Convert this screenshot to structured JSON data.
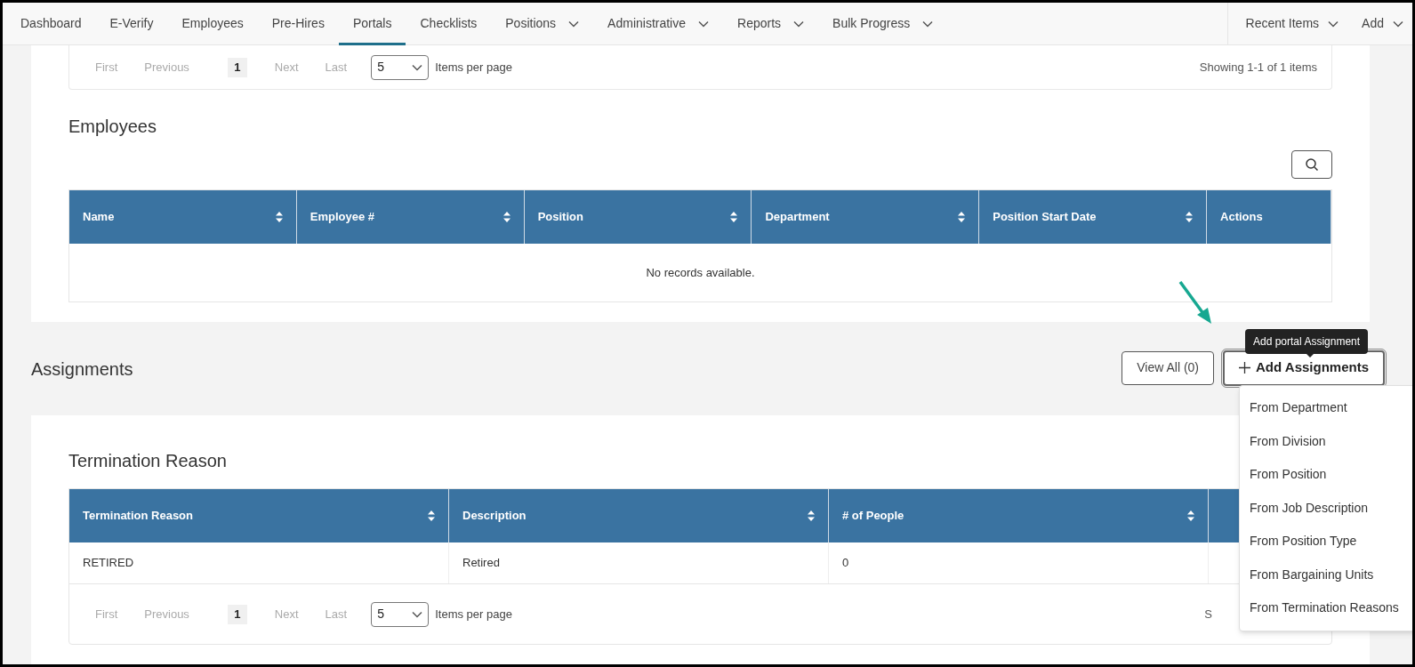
{
  "nav": {
    "items": [
      {
        "label": "Dashboard",
        "dropdown": false,
        "selected": false
      },
      {
        "label": "E-Verify",
        "dropdown": false,
        "selected": false
      },
      {
        "label": "Employees",
        "dropdown": false,
        "selected": false
      },
      {
        "label": "Pre-Hires",
        "dropdown": false,
        "selected": false
      },
      {
        "label": "Portals",
        "dropdown": false,
        "selected": true
      },
      {
        "label": "Checklists",
        "dropdown": false,
        "selected": false
      },
      {
        "label": "Positions",
        "dropdown": true,
        "selected": false
      },
      {
        "label": "Administrative",
        "dropdown": true,
        "selected": false
      },
      {
        "label": "Reports",
        "dropdown": true,
        "selected": false
      },
      {
        "label": "Bulk Progress",
        "dropdown": true,
        "selected": false
      }
    ],
    "right": [
      {
        "label": "Recent Items"
      },
      {
        "label": "Add"
      }
    ]
  },
  "top_pager": {
    "items": [
      {
        "kind": "link",
        "label": "First",
        "disabled": true
      },
      {
        "kind": "link",
        "label": "Previous",
        "disabled": true
      },
      {
        "kind": "page",
        "label": "1",
        "selected": true
      },
      {
        "kind": "link",
        "label": "Next",
        "disabled": true
      },
      {
        "kind": "link",
        "label": "Last",
        "disabled": true
      }
    ],
    "per_page": "5",
    "per_page_label": "Items per page",
    "summary": "Showing 1-1 of 1 items"
  },
  "employees": {
    "title": "Employees",
    "columns": [
      {
        "label": "Name",
        "sortable": true
      },
      {
        "label": "Employee #",
        "sortable": true
      },
      {
        "label": "Position",
        "sortable": true
      },
      {
        "label": "Department",
        "sortable": true
      },
      {
        "label": "Position Start Date",
        "sortable": true
      },
      {
        "label": "Actions",
        "sortable": false
      }
    ],
    "empty_message": "No records available."
  },
  "assignments": {
    "title": "Assignments",
    "view_all": "View All (0)",
    "add_button": "Add Assignments",
    "tooltip": "Add portal Assignment",
    "menu": [
      "From Department",
      "From Division",
      "From Position",
      "From Job Description",
      "From Position Type",
      "From Bargaining Units",
      "From Termination Reasons"
    ]
  },
  "termination": {
    "title": "Termination Reason",
    "columns": [
      {
        "label": "Termination Reason",
        "sortable": true
      },
      {
        "label": "Description",
        "sortable": true
      },
      {
        "label": "# of People",
        "sortable": true
      }
    ],
    "rows": [
      [
        "RETIRED",
        "Retired",
        "0"
      ]
    ],
    "pager": {
      "items": [
        {
          "kind": "link",
          "label": "First",
          "disabled": true
        },
        {
          "kind": "link",
          "label": "Previous",
          "disabled": true
        },
        {
          "kind": "page",
          "label": "1",
          "selected": true
        },
        {
          "kind": "link",
          "label": "Next",
          "disabled": true
        },
        {
          "kind": "link",
          "label": "Last",
          "disabled": true
        }
      ],
      "per_page": "5",
      "per_page_label": "Items per page",
      "summary": "S"
    }
  }
}
